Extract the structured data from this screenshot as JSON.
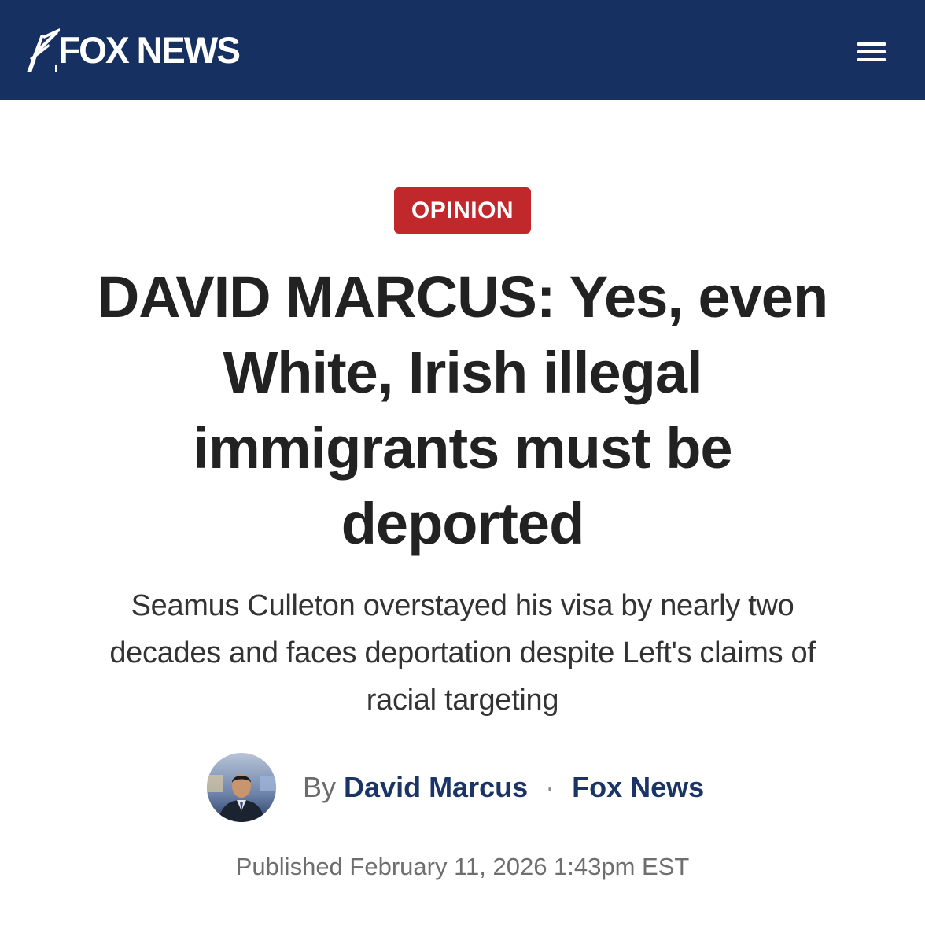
{
  "header": {
    "logo_text": "FOX NEWS",
    "menu_icon": "hamburger-menu-icon",
    "background_color": "#163062"
  },
  "article": {
    "category_badge": "OPINION",
    "badge_color": "#c0282c",
    "headline_lines": [
      "DAVID MARCUS: Yes, even",
      "White, Irish illegal",
      "immigrants must be",
      "deported"
    ],
    "subheadline_lines": [
      "Seamus Culleton overstayed his visa by nearly two",
      "decades and faces deportation despite Left's claims of",
      "racial targeting"
    ],
    "byline": {
      "prefix": "By",
      "author": "David Marcus",
      "separator": "·",
      "source": "Fox News",
      "avatar_icon": "author-avatar"
    },
    "published": "Published February 11, 2026 1:43pm EST"
  }
}
